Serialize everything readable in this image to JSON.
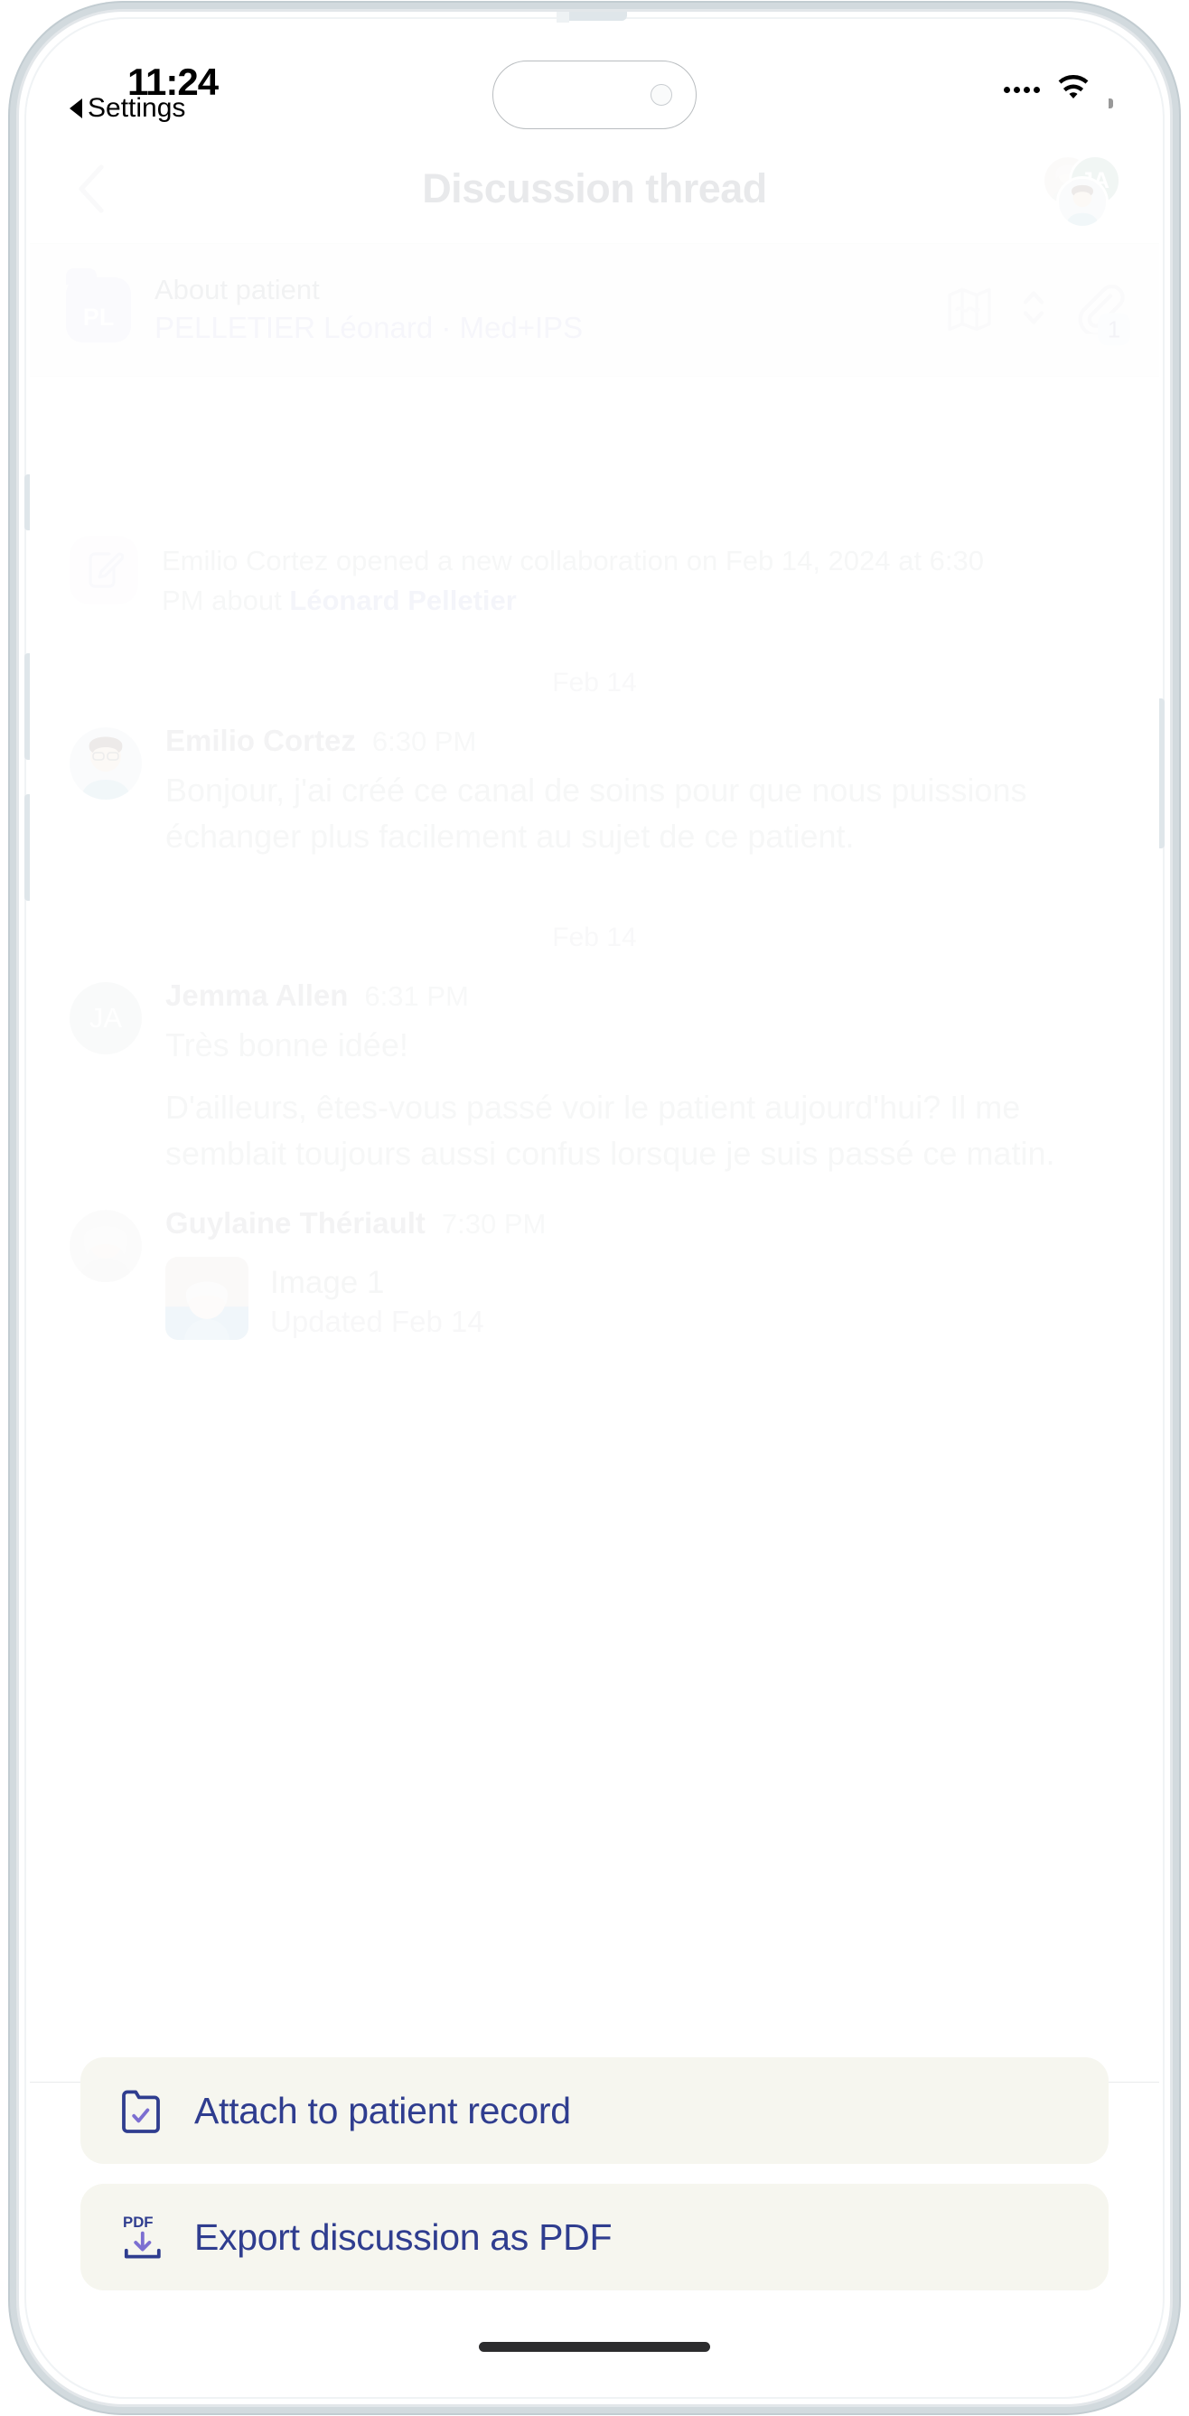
{
  "status_bar": {
    "time": "11:24",
    "back_label": "Settings",
    "back_icon": "triangle-left-icon",
    "cellular_icon": "cellular-dots-icon",
    "wifi_icon": "wifi-icon",
    "battery_icon": "battery-full-icon"
  },
  "nav": {
    "back_icon": "chevron-left-icon",
    "title": "Discussion thread",
    "participants": [
      {
        "type": "photo",
        "name": "Guylaine Thériault"
      },
      {
        "type": "initials",
        "initials": "JA",
        "name": "Jemma Allen",
        "color": "#8fb3a4"
      },
      {
        "type": "photo",
        "name": "Emilio Cortez"
      }
    ]
  },
  "patient_bar": {
    "folder_initials": "PL",
    "label": "About patient",
    "patient_name": "PELLETIER Léonard",
    "separator": "·",
    "record_tag": "Med+IPS",
    "map_icon": "care-plan-map-icon",
    "sort_icon": "chevron-up-down-icon",
    "attachment_icon": "paperclip-icon",
    "attachment_count": "1"
  },
  "thread": {
    "system_event": {
      "icon": "note-edit-icon",
      "text_before": "Emilio Cortez opened a new collaboration on Feb 14, 2024 at 6:30 PM about ",
      "subject": "Léonard Pelletier"
    },
    "groups": [
      {
        "date": "Feb 14",
        "messages": [
          {
            "author": "Emilio Cortez",
            "time": "6:30 PM",
            "avatar_type": "photo",
            "paragraphs": [
              "Bonjour, j'ai créé ce canal de soins pour que nous puissions échanger plus facilement au sujet de ce patient."
            ]
          }
        ]
      },
      {
        "date": "Feb 14",
        "messages": [
          {
            "author": "Jemma Allen",
            "time": "6:31 PM",
            "avatar_type": "initials",
            "initials": "JA",
            "paragraphs": [
              "Très bonne idée!",
              "D'ailleurs, êtes-vous passé voir le patient aujourd'hui? Il me semblait toujours aussi confus lorsque je suis passé ce matin."
            ]
          },
          {
            "author": "Guylaine Thériault",
            "time": "7:30 PM",
            "avatar_type": "photo",
            "paragraphs": [],
            "attachment": {
              "name": "Image 1",
              "subtitle": "Updated Feb 14",
              "thumb": "patient-photo-thumb"
            }
          }
        ]
      }
    ]
  },
  "action_sheet": {
    "items": [
      {
        "icon": "folder-check-icon",
        "label": "Attach to patient record"
      },
      {
        "icon": "pdf-download-icon",
        "label": "Export discussion as PDF"
      }
    ]
  },
  "colors": {
    "accent_navy": "#2f3d8f",
    "accent_purple": "#7c6fd1",
    "sheet_background": "#f6f6ef",
    "patient_bar_background": "#fbfbf7",
    "avatar_green": "#8fb3a4",
    "folder_purple": "#d9d7ef"
  }
}
